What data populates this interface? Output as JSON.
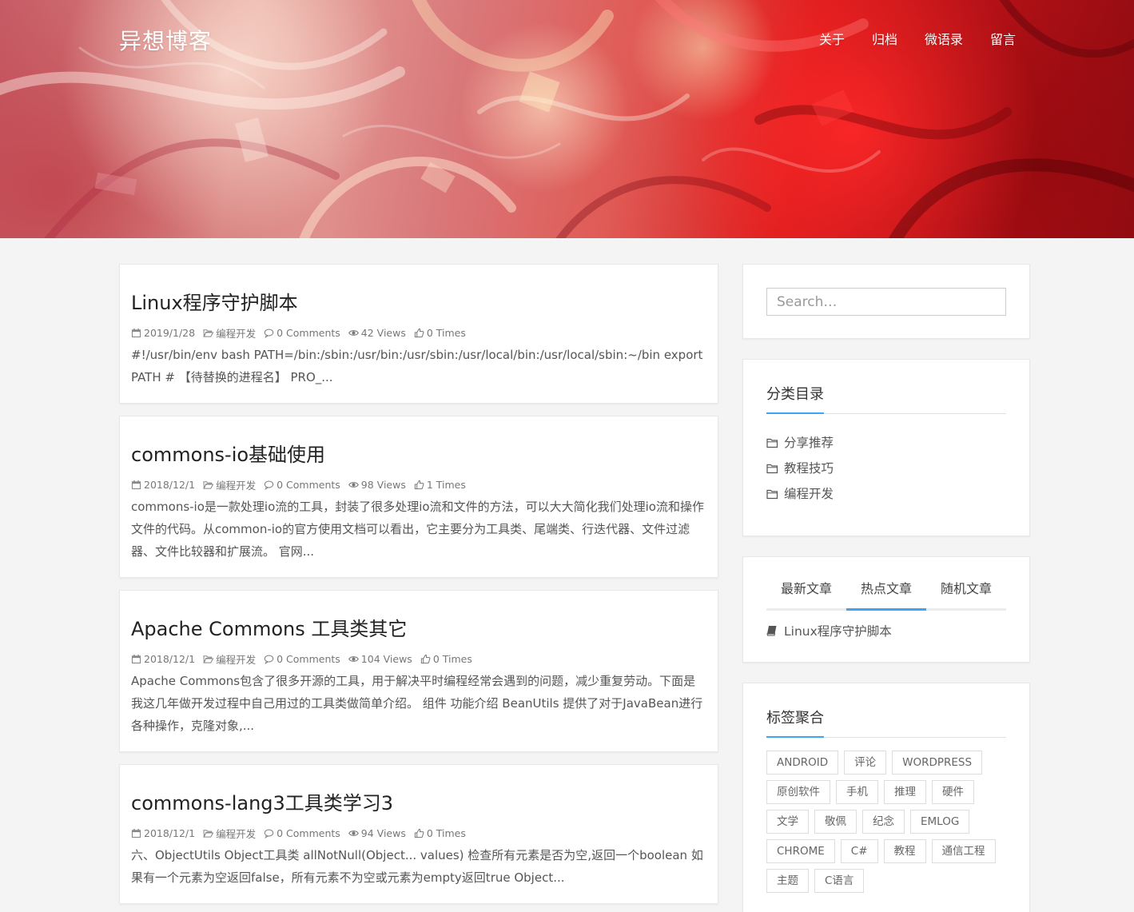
{
  "header": {
    "brand": "异想博客",
    "nav": [
      "关于",
      "归档",
      "微语录",
      "留言"
    ]
  },
  "posts": [
    {
      "title": "Linux程序守护脚本",
      "date": "2019/1/28",
      "category": "编程开发",
      "comments": "0 Comments",
      "views": "42 Views",
      "likes": "0 Times",
      "excerpt": "#!/usr/bin/env bash PATH=/bin:/sbin:/usr/bin:/usr/sbin:/usr/local/bin:/usr/local/sbin:~/bin export PATH # 【待替换的进程名】 PRO_..."
    },
    {
      "title": "commons-io基础使用",
      "date": "2018/12/1",
      "category": "编程开发",
      "comments": "0 Comments",
      "views": "98 Views",
      "likes": "1 Times",
      "excerpt": "commons-io是一款处理io流的工具，封装了很多处理io流和文件的方法，可以大大简化我们处理io流和操作文件的代码。从common-io的官方使用文档可以看出，它主要分为工具类、尾端类、行迭代器、文件过滤器、文件比较器和扩展流。 官网..."
    },
    {
      "title": "Apache Commons 工具类其它",
      "date": "2018/12/1",
      "category": "编程开发",
      "comments": "0 Comments",
      "views": "104 Views",
      "likes": "0 Times",
      "excerpt": "Apache Commons包含了很多开源的工具，用于解决平时编程经常会遇到的问题，减少重复劳动。下面是我这几年做开发过程中自己用过的工具类做简单介绍。 组件 功能介绍 BeanUtils 提供了对于JavaBean进行各种操作，克隆对象,..."
    },
    {
      "title": "commons-lang3工具类学习3",
      "date": "2018/12/1",
      "category": "编程开发",
      "comments": "0 Comments",
      "views": "94 Views",
      "likes": "0 Times",
      "excerpt": "六、ObjectUtils Object工具类 allNotNull(Object... values) 检查所有元素是否为空,返回一个boolean 如果有一个元素为空返回false，所有元素不为空或元素为empty返回true Object..."
    }
  ],
  "sidebar": {
    "search_placeholder": "Search…",
    "categories_title": "分类目录",
    "categories": [
      "分享推荐",
      "教程技巧",
      "编程开发"
    ],
    "tabs": [
      "最新文章",
      "热点文章",
      "随机文章"
    ],
    "active_tab": "热点文章",
    "hot_posts": [
      "Linux程序守护脚本"
    ],
    "tags_title": "标签聚合",
    "tags": [
      "ANDROID",
      "评论",
      "WORDPRESS",
      "原创软件",
      "手机",
      "推理",
      "硬件",
      "文学",
      "敬佩",
      "纪念",
      "EMLOG",
      "CHROME",
      "C#",
      "教程",
      "通信工程",
      "主题",
      "C语言"
    ]
  },
  "colors": {
    "accent": "#3ca5f6",
    "hero_red": "#d81b1b"
  }
}
